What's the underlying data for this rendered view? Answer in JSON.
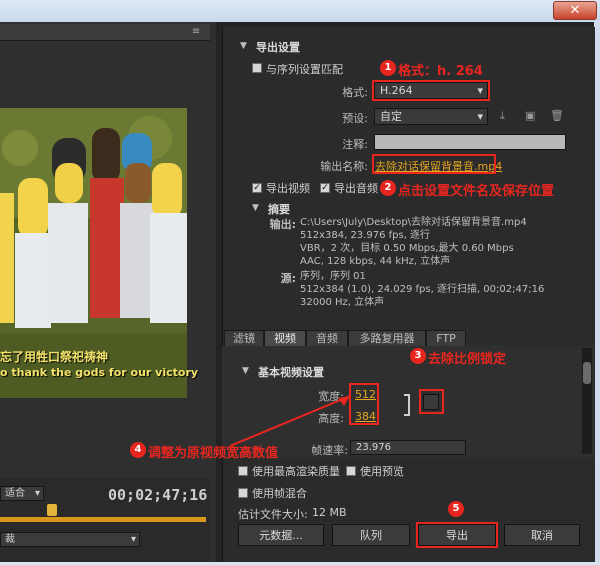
{
  "window": {
    "close_glyph": "✕"
  },
  "left": {
    "menu_glyph": "≡",
    "subtitle_zh": "忘了用牲口祭祀祷神",
    "subtitle_en": "o thank the gods for our victory",
    "fit_select": "适合",
    "timecode": "00;02;47;16",
    "bottom_select": "裁"
  },
  "export_settings": {
    "section_title": "导出设置",
    "match_sequence_label": "与序列设置匹配",
    "format_label": "格式:",
    "format_value": "H.264",
    "preset_label": "预设:",
    "preset_value": "自定",
    "comment_label": "注释:",
    "comment_value": "",
    "output_name_label": "输出名称:",
    "output_name_value": "去除对话保留背景音.mp4",
    "export_video_label": "导出视频",
    "export_audio_label": "导出音频"
  },
  "summary": {
    "title": "摘要",
    "output_label": "输出:",
    "output_lines": [
      "C:\\Users\\July\\Desktop\\去除对话保留背景音.mp4",
      "512x384, 23.976 fps, 逐行",
      "VBR，2 次，目标 0.50 Mbps,最大 0.60 Mbps",
      "AAC, 128 kbps, 44 kHz, 立体声"
    ],
    "source_label": "源:",
    "source_lines": [
      "序列，序列 01",
      "512x384 (1.0), 24.029 fps, 逐行扫描, 00;02;47;16",
      "32000 Hz, 立体声"
    ]
  },
  "tabs": [
    "滤镜",
    "视频",
    "音频",
    "多路复用器",
    "FTP"
  ],
  "video_settings": {
    "title": "基本视频设置",
    "width_label": "宽度:",
    "width_value": "512",
    "height_label": "高度:",
    "height_value": "384",
    "framerate_label": "帧速率:",
    "framerate_value": "23.976"
  },
  "options": {
    "max_render_label": "使用最高渲染质量",
    "use_preview_label": "使用预览",
    "frame_blend_label": "使用帧混合",
    "filesize_label": "估计文件大小:",
    "filesize_value": "12 MB"
  },
  "buttons": {
    "metadata": "元数据...",
    "queue": "队列",
    "export": "导出",
    "cancel": "取消"
  },
  "annotations": {
    "a1": {
      "num": "1",
      "text": "格式：h. 264"
    },
    "a2": {
      "num": "2",
      "text": "点击设置文件名及保存位置"
    },
    "a3": {
      "num": "3",
      "text": "去除比例锁定"
    },
    "a4": {
      "num": "4",
      "text": "调整为原视频宽高数值"
    },
    "a5": {
      "num": "5"
    }
  },
  "colors": {
    "accent_orange": "#e6a51f",
    "annotation_red": "#e8261f"
  }
}
